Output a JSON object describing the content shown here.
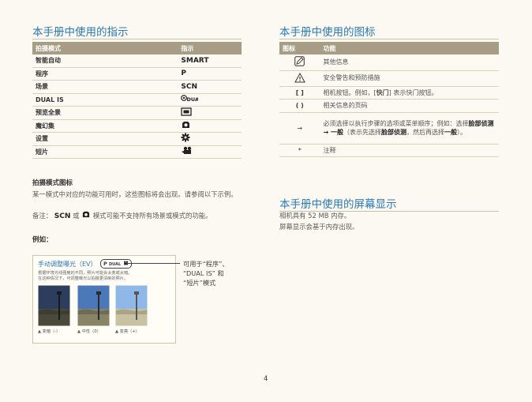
{
  "left": {
    "title": "本手册中使用的指示",
    "table": {
      "headers": [
        "拍摄模式",
        "指示"
      ],
      "rows": [
        {
          "mode": "智能自动",
          "indicator": "SMART"
        },
        {
          "mode": "程序",
          "indicator": "P"
        },
        {
          "mode": "场景",
          "indicator": "SCN"
        },
        {
          "mode": "DUAL IS",
          "indicator": "DUAL"
        },
        {
          "mode": "预览全景",
          "indicator": "panorama-icon"
        },
        {
          "mode": "魔幻集",
          "indicator": "magic-icon"
        },
        {
          "mode": "设置",
          "indicator": "settings-icon"
        },
        {
          "mode": "短片",
          "indicator": "movie-icon"
        }
      ]
    },
    "mode_icons_heading": "拍摄模式图标",
    "mode_icons_text": "某一模式中对应的功能可用时，这些图标将会出现。请参阅以下示例。",
    "note_prefix": "备注：",
    "note_scn": "SCN",
    "note_or": "或",
    "note_suffix": "模式可能不支持所有场景或模式的功能。",
    "example_heading": "例如：",
    "example": {
      "title": "手动调整曝光（EV）",
      "badge_p": "P",
      "badge_dual": "DUAL",
      "desc1": "根据环境光线强度的不同，照片可能会太亮或太暗。",
      "desc2": "在这种情况下，可调整曝光以拍摄更清晰的照片。",
      "captions": [
        "▲ 变暗（-）",
        "▲ 中性（0）",
        "▲ 变亮（+）"
      ],
      "callout_line1": "可用于“程序”、",
      "callout_line2": "“DUAL IS” 和",
      "callout_line3": "“短片”模式"
    }
  },
  "right": {
    "title": "本手册中使用的图标",
    "table": {
      "headers": [
        "图标",
        "功能"
      ],
      "rows": [
        {
          "icon": "note-icon",
          "func": "其他信息"
        },
        {
          "icon": "warning-icon",
          "func": "安全警告和预防措施"
        },
        {
          "icon": "[  ]",
          "func_a": "相机按钮。例如，[",
          "func_b": "快门",
          "func_c": "] 表示快门按钮。"
        },
        {
          "icon": "(  )",
          "func": "相关信息的页码"
        },
        {
          "icon": "→",
          "func_a": "必须选择以执行步骤的选项或菜单顺序；例如：选择",
          "func_b": "脸部侦测 → 一般",
          "func_c": "（表示先选择",
          "func_d": "脸部侦测",
          "func_e": "，然后再选择",
          "func_f": "一般",
          "func_g": "）。"
        },
        {
          "icon": "*",
          "func": "注释"
        }
      ]
    },
    "screen_title": "本手册中使用的屏幕显示",
    "screen_line1": "相机具有 52 MB 内存。",
    "screen_line2": "屏幕显示会基于内存出现。"
  },
  "page_number": "4",
  "colors": {
    "accent": "#2a79b9",
    "header_bg": "#a79d85",
    "page_bg": "#fbf9f1"
  }
}
